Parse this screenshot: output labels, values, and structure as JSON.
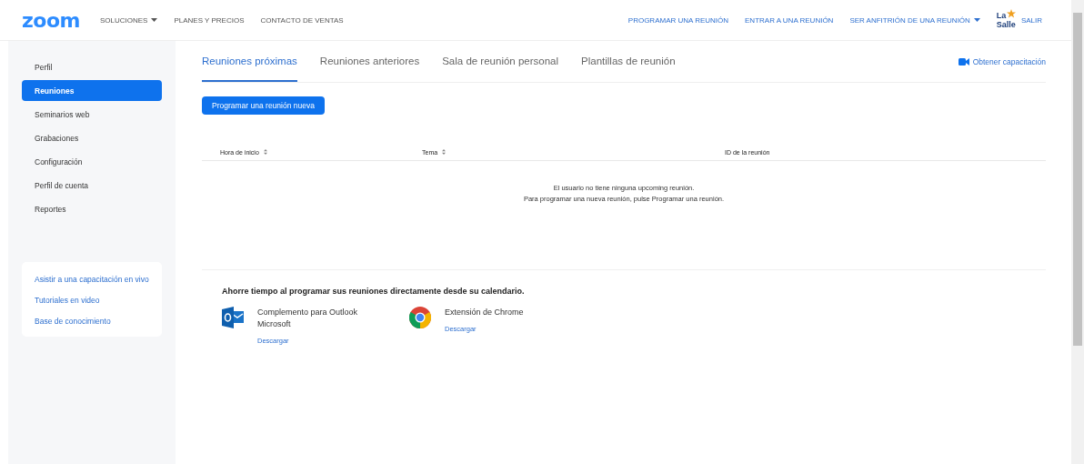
{
  "header": {
    "logo": "zoom",
    "nav_left": [
      {
        "label": "SOLUCIONES",
        "dropdown": true
      },
      {
        "label": "PLANES Y PRECIOS",
        "dropdown": false
      },
      {
        "label": "CONTACTO DE VENTAS",
        "dropdown": false
      }
    ],
    "nav_right": [
      {
        "label": "PROGRAMAR UNA REUNIÓN",
        "dropdown": false
      },
      {
        "label": "ENTRAR A UNA REUNIÓN",
        "dropdown": false
      },
      {
        "label": "SER ANFITRIÓN DE UNA REUNIÓN",
        "dropdown": true
      }
    ],
    "org_logo": [
      "La",
      "Salle"
    ],
    "signout": "SALIR"
  },
  "sidebar": {
    "items": [
      {
        "label": "Perfil",
        "selected": false
      },
      {
        "label": "Reuniones",
        "selected": true
      },
      {
        "label": "Seminarios web",
        "selected": false
      },
      {
        "label": "Grabaciones",
        "selected": false
      },
      {
        "label": "Configuración",
        "selected": false
      },
      {
        "label": "Perfil de cuenta",
        "selected": false
      },
      {
        "label": "Reportes",
        "selected": false
      }
    ],
    "links": [
      "Asistir a una capacitación en vivo",
      "Tutoriales en video",
      "Base de conocimiento"
    ]
  },
  "tabs": [
    {
      "label": "Reuniones próximas",
      "selected": true
    },
    {
      "label": "Reuniones anteriores",
      "selected": false
    },
    {
      "label": "Sala de reunión personal",
      "selected": false
    },
    {
      "label": "Plantillas de reunión",
      "selected": false
    }
  ],
  "training_link": "Obtener capacitación",
  "new_meeting_button": "Programar una reunión nueva",
  "table": {
    "columns": [
      {
        "label": "Hora de inicio",
        "sortable": true
      },
      {
        "label": "Tema",
        "sortable": true
      },
      {
        "label": "ID de la reunión",
        "sortable": false
      }
    ],
    "empty_message": [
      "El usuario no tiene ninguna upcoming reunión.",
      "Para programar una nueva reunión, pulse Programar una reunión."
    ]
  },
  "calendar": {
    "title": "Ahorre tiempo al programar sus reuniones directamente desde su calendario.",
    "plugins": [
      {
        "kind": "outlook",
        "name": "Complemento para Outlook Microsoft",
        "link": "Descargar"
      },
      {
        "kind": "chrome",
        "name": "Extensión de Chrome",
        "link": "Descargar"
      }
    ]
  }
}
